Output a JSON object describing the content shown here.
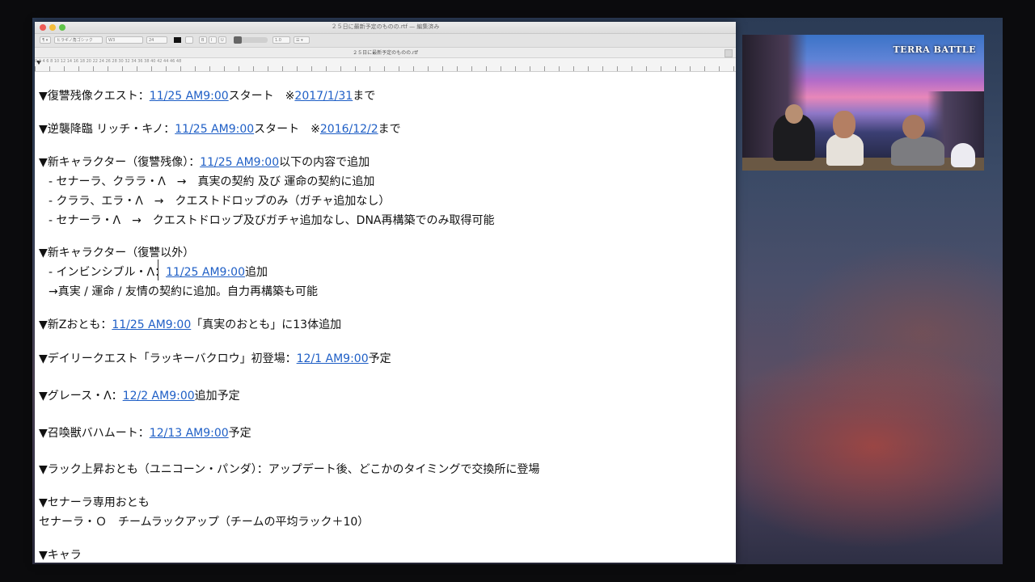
{
  "window": {
    "title": "２５日に最新予定のものの.rtf — 編集済み",
    "info_bar": "２５日に最新予定のものの.rtf",
    "toolbar": {
      "style_select": "¶ ▾",
      "font_family": "ヒラギノ角ゴシック",
      "font_weight": "W3",
      "font_size": "24",
      "bold_button": "B",
      "italic_button": "I",
      "underline_button": "U",
      "line_spacing": "1.0",
      "list_select": "☰ ▾"
    },
    "ruler_numbers": "0    2    4    6    8    10    12    14    16    18    20    22    24    26    28    30    32    34    36    38    40    42    44    46    48"
  },
  "document": {
    "lines": [
      {
        "pre": "▼復讐残像クエスト：",
        "link": "11/25 AM9:00",
        "mid": "スタート　※",
        "link2": "2017/1/31",
        "post": "まで"
      },
      {
        "pre": "▼逆襲降臨 リッチ・キノ：",
        "link": "11/25 AM9:00",
        "mid": "スタート　※",
        "link2": "2016/12/2",
        "post": "まで"
      },
      {
        "pre": "▼新キャラクター（復讐残像）：",
        "link": "11/25 AM9:00",
        "post": "以下の内容で追加"
      },
      {
        "text": " - セナーラ、クララ・Λ　→　真実の契約 及び 運命の契約に追加"
      },
      {
        "text": " - クララ、エラ・Λ　→　クエストドロップのみ（ガチャ追加なし）"
      },
      {
        "text": " - セナーラ・Λ　→　クエストドロップ及びガチャ追加なし、DNA再構築でのみ取得可能"
      },
      {
        "text": "▼新キャラクター（復讐以外）"
      },
      {
        "pre": " - インビンシブル・Λ：",
        "link": "11/25 AM9:00",
        "post": "追加"
      },
      {
        "text": " →真実 / 運命 / 友情の契約に追加。自力再構築も可能"
      },
      {
        "pre": "▼新Zおとも：",
        "link": "11/25 AM9:00",
        "post": "「真実のおとも」に13体追加"
      },
      {
        "pre": "▼デイリークエスト「ラッキーバクロウ」初登場：",
        "link": "12/1 AM9:00",
        "post": "予定"
      },
      {
        "pre": "▼グレース・Λ：",
        "link": "12/2 AM9:00",
        "post": "追加予定"
      },
      {
        "pre": "▼召喚獣バハムート：",
        "link": "12/13 AM9:00",
        "post": "予定"
      },
      {
        "text": "▼ラック上昇おとも（ユニコーン・パンダ）：アップデート後、どこかのタイミングで交換所に登場"
      },
      {
        "text": "▼セナーラ専用おとも"
      },
      {
        "text": "セナーラ・Ｏ　チームラックアップ（チームの平均ラック＋10）"
      },
      {
        "text": "▼キャラ"
      }
    ]
  },
  "stream": {
    "brand_logo": "TERRA BATTLE"
  },
  "colors": {
    "link": "#1f5fc6",
    "text": "#111111"
  }
}
